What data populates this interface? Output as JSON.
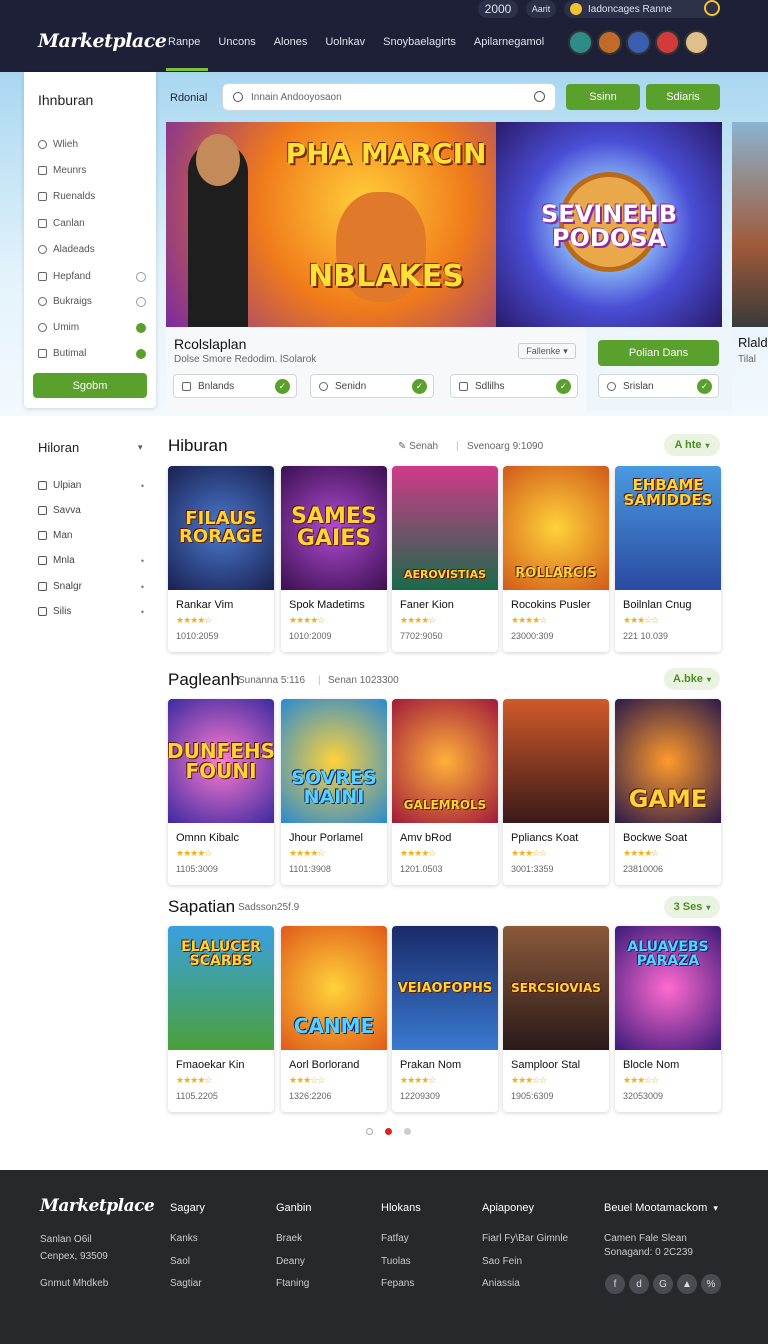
{
  "header": {
    "logo": "Marketplace",
    "nav": [
      "Ranpe",
      "Uncons",
      "Alones",
      "Uolnkav",
      "Snoybaelagirts",
      "Apilarnegamol"
    ],
    "balance": "2000",
    "currency_label": "Aarit",
    "search_text": "Iadoncages Ranne"
  },
  "sidebar": {
    "title": "Ihnburan",
    "items": [
      "Wlieh",
      "Meunrs",
      "Ruenalds",
      "Canlan",
      "Aladeads",
      "Hepfand",
      "Bukraigs",
      "Umim",
      "Butimal"
    ],
    "button": "Sgobm"
  },
  "top": {
    "label": "Rdonial",
    "search_placeholder": "Innain Andooyosaon",
    "btn1": "Ssinn",
    "btn2": "Sdiaris"
  },
  "banners": [
    {
      "title": "PHA MARCIN",
      "subtitle": "NBLAKES"
    },
    {
      "title": "SEVINEHB PODOSA"
    }
  ],
  "promo": {
    "title": "Rcolslaplan",
    "subtitle": "Dolse Smore Redodim. lSolarok",
    "dropdown": "Fallenke",
    "chips": [
      "Bnlands",
      "Senidn",
      "Sdlilhs"
    ],
    "side_button": "Polian Dans",
    "side_chip": "Srislan",
    "edge_title": "Rlald",
    "edge_sub": "Tilal"
  },
  "left_nav": {
    "title": "Hiloran",
    "items": [
      "Ulpian",
      "Savva",
      "Man",
      "Mnla",
      "Snalgr",
      "Silis"
    ]
  },
  "sections": [
    {
      "title": "Hiburan",
      "sub1": "Senah",
      "sub2": "Svenoarg 9:1090",
      "button": "A hte",
      "cards": [
        {
          "art": "FILAUS RORAGE",
          "name": "Rankar Vim",
          "stars": "★★★★☆",
          "price": "1010:2059"
        },
        {
          "art": "SAMES GAIES",
          "name": "Spok Madetims",
          "stars": "★★★★☆",
          "price": "1010:2009"
        },
        {
          "art": "AEROVISTIAS",
          "name": "Faner Kion",
          "stars": "★★★★☆",
          "price": "7702:9050"
        },
        {
          "art": "ROLLARCIS",
          "name": "Rocokins Pusler",
          "stars": "★★★★☆",
          "price": "23000:309"
        },
        {
          "art": "EHBAME SAMIDDES",
          "name": "Boilnlan Cnug",
          "stars": "★★★☆☆",
          "price": "221 10.039"
        }
      ]
    },
    {
      "title": "Pagleanh",
      "sub1": "Sunanna 5:116",
      "sub2": "Senan 1023300",
      "button": "A.bke",
      "cards": [
        {
          "art": "DUNFEHS FOUNI",
          "name": "Omnn Kibalc",
          "stars": "★★★★☆",
          "price": "1105:3009"
        },
        {
          "art": "SOVRES NAINI",
          "name": "Jhour Porlamel",
          "stars": "★★★★☆",
          "price": "1101:3908"
        },
        {
          "art": "GALEMROLS",
          "name": "Amv bRod",
          "stars": "★★★★☆",
          "price": "1201.0503"
        },
        {
          "art": "",
          "name": "Ppliancs Koat",
          "stars": "★★★☆☆",
          "price": "3001:3359"
        },
        {
          "art": "GAME",
          "name": "Bockwe Soat",
          "stars": "★★★★☆",
          "price": "23810006"
        }
      ]
    },
    {
      "title": "Sapatian",
      "sub1": "Sadsson25f.9",
      "sub2": "",
      "button": "3 Ses",
      "cards": [
        {
          "art": "ELALUCER SCARBS",
          "name": "Fmaoekar Kin",
          "stars": "★★★★☆",
          "price": "1105.2205"
        },
        {
          "art": "CANME",
          "name": "Aorl Borlorand",
          "stars": "★★★☆☆",
          "price": "1326:2206"
        },
        {
          "art": "VEIAOFOPHS",
          "name": "Prakan Nom",
          "stars": "★★★★☆",
          "price": "12209309"
        },
        {
          "art": "SERCSIOVIAS",
          "name": "Samploor Stal",
          "stars": "★★★☆☆",
          "price": "1905:6309"
        },
        {
          "art": "ALUAVEBS PARAZA",
          "name": "Blocle Nom",
          "stars": "★★★☆☆",
          "price": "32053009"
        }
      ]
    }
  ],
  "footer": {
    "logo": "Marketplace",
    "addr1": "Sanlan O6il",
    "addr2": "Cenpex, 93509",
    "addr3": "Gnmut Mhdkeb",
    "col1": {
      "h": "Sagary",
      "items": [
        "Kanks",
        "Saol",
        "Sagtiar"
      ]
    },
    "col2": {
      "h": "Ganbin",
      "items": [
        "Braek",
        "Deany",
        "Ftaning"
      ]
    },
    "col3": {
      "h": "Hlokans",
      "items": [
        "Fatfay",
        "Tuolas",
        "Fepans"
      ]
    },
    "col4": {
      "h": "Apiaponey",
      "items": [
        "Fiarl Fy\\Bar Gimnle",
        "Sao Fein",
        "Aniassia"
      ]
    },
    "col5": {
      "h": "Beuel Mootamackom",
      "items": [
        "Camen Fale Slean",
        "Sonagand: 0 2C239"
      ]
    },
    "social": [
      "f",
      "d",
      "G",
      "▲",
      "%"
    ]
  },
  "colors": {
    "header_bg": "#1d2036",
    "accent": "#5aa02c",
    "footer_bg": "#27282c"
  }
}
